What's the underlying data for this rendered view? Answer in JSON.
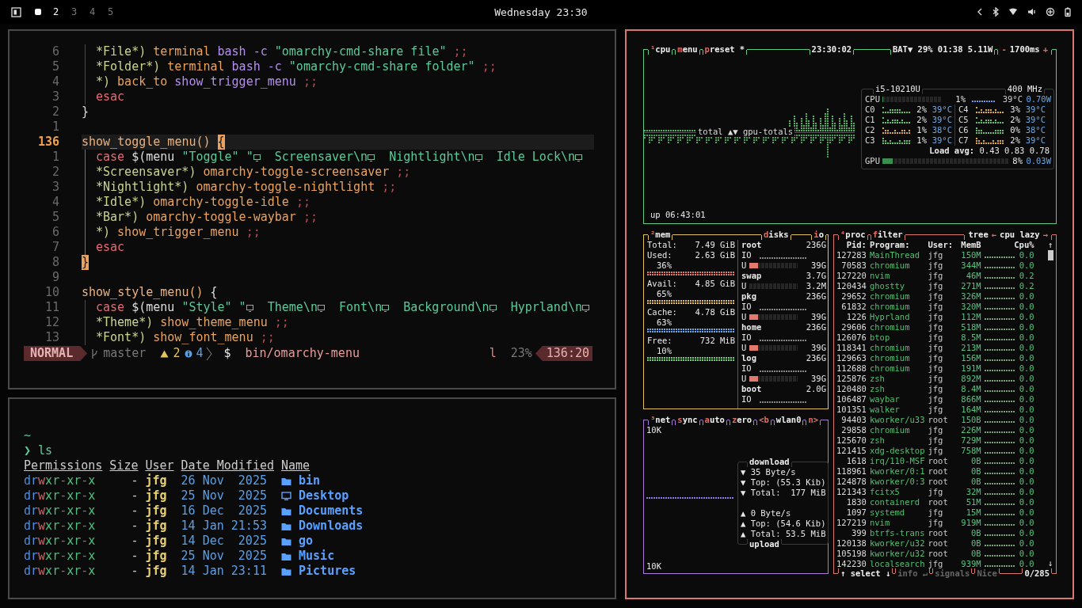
{
  "top_bar": {
    "workspaces": [
      {
        "kind": "icon",
        "selected": true
      },
      {
        "kind": "number",
        "label": "2",
        "selected": false,
        "occupied": true
      },
      {
        "kind": "number",
        "label": "3",
        "selected": false,
        "occupied": false
      },
      {
        "kind": "number",
        "label": "4",
        "selected": false,
        "occupied": false
      },
      {
        "kind": "number",
        "label": "5",
        "selected": false,
        "occupied": false
      }
    ],
    "clock": "Wednesday 23:30"
  },
  "editor": {
    "lines": [
      {
        "number": "6",
        "current": false,
        "guide": true,
        "active_scope": false,
        "tokens": [
          {
            "kind": "pattern",
            "text": "*File*) "
          },
          {
            "kind": "command",
            "text": "terminal "
          },
          {
            "kind": "builtin",
            "text": "bash -c "
          },
          {
            "kind": "string",
            "text": "\"omarchy-cmd-share file\" "
          },
          {
            "kind": "punct",
            "text": ";;"
          }
        ]
      },
      {
        "number": "5",
        "current": false,
        "guide": true,
        "active_scope": false,
        "tokens": [
          {
            "kind": "pattern",
            "text": "*Folder*) "
          },
          {
            "kind": "command",
            "text": "terminal "
          },
          {
            "kind": "builtin",
            "text": "bash -c "
          },
          {
            "kind": "string",
            "text": "\"omarchy-cmd-share folder\" "
          },
          {
            "kind": "punct",
            "text": ";;"
          }
        ]
      },
      {
        "number": "4",
        "current": false,
        "guide": true,
        "active_scope": false,
        "tokens": [
          {
            "kind": "pattern",
            "text": "*) "
          },
          {
            "kind": "command",
            "text": "back_to "
          },
          {
            "kind": "builtin",
            "text": "show_trigger_menu "
          },
          {
            "kind": "punct",
            "text": ";;"
          }
        ]
      },
      {
        "number": "3",
        "current": false,
        "guide": true,
        "active_scope": false,
        "tokens": [
          {
            "kind": "keyword",
            "text": "esac"
          }
        ]
      },
      {
        "number": "2",
        "current": false,
        "tokens": [
          {
            "kind": "plain",
            "text": "}"
          }
        ]
      },
      {
        "number": "1",
        "current": false
      },
      {
        "number": "136",
        "current": true,
        "tokens": [
          {
            "kind": "func",
            "text": "show_toggle_menu() "
          },
          {
            "kind": "match",
            "text": "{"
          }
        ]
      },
      {
        "number": "1",
        "current": false,
        "guide": true,
        "active_scope": true,
        "tokens": [
          {
            "kind": "keyword",
            "text": "case "
          },
          {
            "kind": "plain",
            "text": "$(menu "
          },
          {
            "kind": "string",
            "text": "\"Toggle\" \""
          },
          {
            "kind": "icon"
          },
          {
            "kind": "string",
            "text": "  Screensaver\\n"
          },
          {
            "kind": "icon"
          },
          {
            "kind": "string",
            "text": "  Nightlight\\n"
          },
          {
            "kind": "icon"
          },
          {
            "kind": "string",
            "text": "  Idle Lock\\n"
          },
          {
            "kind": "icon"
          }
        ]
      },
      {
        "number": "2",
        "current": false,
        "guide": true,
        "active_scope": true,
        "tokens": [
          {
            "kind": "pattern",
            "text": "*Screensaver*) "
          },
          {
            "kind": "command",
            "text": "omarchy-toggle-screensaver "
          },
          {
            "kind": "punct",
            "text": ";;"
          }
        ]
      },
      {
        "number": "3",
        "current": false,
        "guide": true,
        "active_scope": true,
        "tokens": [
          {
            "kind": "pattern",
            "text": "*Nightlight*) "
          },
          {
            "kind": "command",
            "text": "omarchy-toggle-nightlight "
          },
          {
            "kind": "punct",
            "text": ";;"
          }
        ]
      },
      {
        "number": "4",
        "current": false,
        "guide": true,
        "active_scope": true,
        "tokens": [
          {
            "kind": "pattern",
            "text": "*Idle*) "
          },
          {
            "kind": "command",
            "text": "omarchy-toggle-idle "
          },
          {
            "kind": "punct",
            "text": ";;"
          }
        ]
      },
      {
        "number": "5",
        "current": false,
        "guide": true,
        "active_scope": true,
        "tokens": [
          {
            "kind": "pattern",
            "text": "*Bar*) "
          },
          {
            "kind": "command",
            "text": "omarchy-toggle-waybar "
          },
          {
            "kind": "punct",
            "text": ";;"
          }
        ]
      },
      {
        "number": "6",
        "current": false,
        "guide": true,
        "active_scope": true,
        "tokens": [
          {
            "kind": "pattern",
            "text": "*) "
          },
          {
            "kind": "command",
            "text": "show_trigger_menu "
          },
          {
            "kind": "punct",
            "text": ";;"
          }
        ]
      },
      {
        "number": "7",
        "current": false,
        "guide": true,
        "active_scope": true,
        "tokens": [
          {
            "kind": "keyword",
            "text": "esac"
          }
        ]
      },
      {
        "number": "8",
        "current": false,
        "tokens": [
          {
            "kind": "match",
            "text": "}"
          }
        ]
      },
      {
        "number": "9",
        "current": false
      },
      {
        "number": "10",
        "current": false,
        "tokens": [
          {
            "kind": "func",
            "text": "show_style_menu() "
          },
          {
            "kind": "plain",
            "text": "{"
          }
        ]
      },
      {
        "number": "11",
        "current": false,
        "guide": true,
        "active_scope": false,
        "tokens": [
          {
            "kind": "keyword",
            "text": "case "
          },
          {
            "kind": "plain",
            "text": "$(menu "
          },
          {
            "kind": "string",
            "text": "\"Style\" \""
          },
          {
            "kind": "icon"
          },
          {
            "kind": "string",
            "text": "  Theme\\n"
          },
          {
            "kind": "icon"
          },
          {
            "kind": "string",
            "text": "  Font\\n"
          },
          {
            "kind": "icon"
          },
          {
            "kind": "string",
            "text": "  Background\\n"
          },
          {
            "kind": "icon"
          },
          {
            "kind": "string",
            "text": "  Hyprland\\n"
          },
          {
            "kind": "icon"
          }
        ]
      },
      {
        "number": "12",
        "current": false,
        "guide": true,
        "active_scope": false,
        "tokens": [
          {
            "kind": "pattern",
            "text": "*Theme*) "
          },
          {
            "kind": "command",
            "text": "show_theme_menu "
          },
          {
            "kind": "punct",
            "text": ";;"
          }
        ]
      },
      {
        "number": "13",
        "current": false,
        "guide": true,
        "active_scope": false,
        "tokens": [
          {
            "kind": "pattern",
            "text": "*Font*) "
          },
          {
            "kind": "command",
            "text": "show_font_menu "
          },
          {
            "kind": "punct",
            "text": ";;"
          }
        ]
      }
    ],
    "status": {
      "mode": "NORMAL",
      "branch": "master",
      "warnings": "2",
      "infos": "4",
      "prompt": "$",
      "file": "bin/omarchy-menu",
      "flag": "l",
      "percent": "23%",
      "position": "136:20"
    }
  },
  "shell": {
    "cwd": "~",
    "prompt": "❯",
    "command": "ls",
    "columns": [
      "Permissions",
      "Size",
      "User",
      "Date Modified",
      "Name"
    ],
    "rows": [
      {
        "permissions": "drwxr-xr-x",
        "size": "-",
        "user": "jfg",
        "date": "26 Nov  2025",
        "name": "bin",
        "kind": "folder"
      },
      {
        "permissions": "drwxr-xr-x",
        "size": "-",
        "user": "jfg",
        "date": "25 Nov  2025",
        "name": "Desktop",
        "kind": "monitor"
      },
      {
        "permissions": "drwxr-xr-x",
        "size": "-",
        "user": "jfg",
        "date": "16 Dec  2025",
        "name": "Documents",
        "kind": "folder"
      },
      {
        "permissions": "drwxr-xr-x",
        "size": "-",
        "user": "jfg",
        "date": "14 Jan 21:53",
        "name": "Downloads",
        "kind": "folder"
      },
      {
        "permissions": "drwxr-xr-x",
        "size": "-",
        "user": "jfg",
        "date": "14 Dec  2025",
        "name": "go",
        "kind": "folder"
      },
      {
        "permissions": "drwxr-xr-x",
        "size": "-",
        "user": "jfg",
        "date": "25 Nov  2025",
        "name": "Music",
        "kind": "folder"
      },
      {
        "permissions": "drwxr-xr-x",
        "size": "-",
        "user": "jfg",
        "date": "14 Jan 23:11",
        "name": "Pictures",
        "kind": "folder"
      }
    ]
  },
  "monitor": {
    "cpu": {
      "tabs": [
        {
          "text": "¹cpu",
          "kind": "hotkey"
        },
        {
          "text": "menu",
          "kind": "hotkey"
        },
        {
          "text": "preset *",
          "kind": "hotkey"
        }
      ],
      "clock": "23:30:02",
      "battery": "BAT▼ 29% 01:38 5.11W",
      "interval": [
        {
          "text": "-",
          "kind": "control"
        },
        {
          "text": "1700ms",
          "kind": "plain"
        },
        {
          "text": "+",
          "kind": "control"
        }
      ],
      "graph_label": "total ▲▼ gpu-totals",
      "uptime": "up 06:43:01",
      "model": "i5-10210U",
      "frequency": "400 MHz",
      "total": {
        "label": "CPU",
        "percent": "1%",
        "level": 0.01,
        "temp": "39°C",
        "power": "0.70W"
      },
      "cores": [
        {
          "label": "C0",
          "percent": "2%",
          "temp": "39°C"
        },
        {
          "label": "C4",
          "percent": "3%",
          "temp": "39°C"
        },
        {
          "label": "C1",
          "percent": "2%",
          "temp": "39°C"
        },
        {
          "label": "C5",
          "percent": "2%",
          "temp": "39°C"
        },
        {
          "label": "C2",
          "percent": "1%",
          "temp": "38°C"
        },
        {
          "label": "C6",
          "percent": "0%",
          "temp": "38°C"
        },
        {
          "label": "C3",
          "percent": "1%",
          "temp": "39°C"
        },
        {
          "label": "C7",
          "percent": "2%",
          "temp": "39°C"
        }
      ],
      "load": "**Load avg:** 0.43 0.83 0.78",
      "gpu": {
        "label": "GPU",
        "percent": "8%",
        "level": 0.08,
        "power": "0.03W"
      }
    },
    "mem": {
      "title": {
        "text": "²mem",
        "kind": "hotkey"
      },
      "items": [
        {
          "label": "Total:",
          "value": "7.49 GiB"
        },
        {
          "label": "Used:",
          "value": "2.63 GiB",
          "percent": "36%",
          "color": "#e07a6f"
        },
        {
          "label": "Avail:",
          "value": "4.85 GiB",
          "percent": "65%",
          "color": "#e0c060"
        },
        {
          "label": "Cache:",
          "value": "4.78 GiB",
          "percent": "63%",
          "color": "#6aa8e8"
        },
        {
          "label": "Free:",
          "value": "732 MiB",
          "percent": "10%",
          "color": "#6ad07a"
        }
      ]
    },
    "disks": {
      "tabs": [
        {
          "text": "disks",
          "kind": "hotkey"
        },
        {
          "text": "io",
          "kind": "hotkey"
        }
      ],
      "items": [
        {
          "name": "root",
          "size": "236G",
          "io": "IO",
          "usage": {
            "label": "U",
            "value": "39G",
            "level": 0.17
          }
        },
        {
          "name": "swap",
          "size": "3.7G",
          "usage": {
            "label": "U",
            "value": "3.2M",
            "level": 0
          }
        },
        {
          "name": "pkg",
          "size": "236G",
          "io": "IO",
          "usage": {
            "label": "U",
            "value": "39G",
            "level": 0.17
          }
        },
        {
          "name": "home",
          "size": "236G",
          "io": "IO",
          "usage": {
            "label": "U",
            "value": "39G",
            "level": 0.17
          }
        },
        {
          "name": "log",
          "size": "236G",
          "io": "IO",
          "usage": {
            "label": "U",
            "value": "39G",
            "level": 0.17
          }
        },
        {
          "name": "boot",
          "size": "2.0G",
          "io": "IO"
        }
      ]
    },
    "net": {
      "tabs": [
        {
          "text": "³net",
          "kind": "hotkey"
        },
        {
          "text": "sync",
          "kind": "hotkey"
        },
        {
          "text": "auto",
          "kind": "hotkey"
        },
        {
          "text": "zero",
          "kind": "hotkey"
        }
      ],
      "interface": [
        {
          "text": "<b",
          "kind": "control"
        },
        {
          "text": "wlan0",
          "kind": "plain"
        },
        {
          "text": "n>",
          "kind": "control"
        }
      ],
      "scale_top": "10K",
      "scale_bottom": "10K",
      "download_title": "download",
      "download": [
        "▼ 35 Byte/s",
        "▼ Top: (55.3 Kib)",
        "▼ Total:  177 MiB"
      ],
      "upload": [
        "▲ 0 Byte/s",
        "▲ Top: (54.6 Kib)",
        "▲ Total: 53.5 MiB"
      ],
      "upload_title": "upload"
    },
    "proc": {
      "tabs": [
        {
          "text": "⁴proc",
          "kind": "hotkey"
        },
        {
          "text": "filter",
          "kind": "hotkey"
        }
      ],
      "options": [
        {
          "text": "tree",
          "kind": "plain"
        },
        {
          "text": "←",
          "kind": "control"
        },
        {
          "text": "cpu lazy",
          "kind": "plain"
        },
        {
          "text": "→",
          "kind": "control"
        }
      ],
      "columns": [
        "Pid:",
        "Program:",
        "User:",
        "MemB",
        "Cpu%"
      ],
      "scroll_up": "↑",
      "scroll_down": "↓",
      "rows": [
        {
          "pid": "127283",
          "program": "MainThread",
          "user": "jfg",
          "mem": "150M",
          "cpu": "0.0"
        },
        {
          "pid": "70583",
          "program": "chromium",
          "user": "jfg",
          "mem": "344M",
          "cpu": "0.0"
        },
        {
          "pid": "127220",
          "program": "nvim",
          "user": "jfg",
          "mem": "46M",
          "cpu": "0.2"
        },
        {
          "pid": "120434",
          "program": "ghostty",
          "user": "jfg",
          "mem": "271M",
          "cpu": "0.2"
        },
        {
          "pid": "29652",
          "program": "chromium",
          "user": "jfg",
          "mem": "326M",
          "cpu": "0.0"
        },
        {
          "pid": "61832",
          "program": "chromium",
          "user": "jfg",
          "mem": "320M",
          "cpu": "0.0"
        },
        {
          "pid": "1226",
          "program": "Hyprland",
          "user": "jfg",
          "mem": "112M",
          "cpu": "0.0"
        },
        {
          "pid": "29606",
          "program": "chromium",
          "user": "jfg",
          "mem": "518M",
          "cpu": "0.0"
        },
        {
          "pid": "126076",
          "program": "btop",
          "user": "jfg",
          "mem": "8.5M",
          "cpu": "0.0"
        },
        {
          "pid": "118341",
          "program": "chromium",
          "user": "jfg",
          "mem": "213M",
          "cpu": "0.0"
        },
        {
          "pid": "129663",
          "program": "chromium",
          "user": "jfg",
          "mem": "156M",
          "cpu": "0.0"
        },
        {
          "pid": "112688",
          "program": "chromium",
          "user": "jfg",
          "mem": "191M",
          "cpu": "0.0"
        },
        {
          "pid": "125876",
          "program": "zsh",
          "user": "jfg",
          "mem": "892M",
          "cpu": "0.0"
        },
        {
          "pid": "120480",
          "program": "zsh",
          "user": "jfg",
          "mem": "8.4M",
          "cpu": "0.0"
        },
        {
          "pid": "106487",
          "program": "waybar",
          "user": "jfg",
          "mem": "866M",
          "cpu": "0.0"
        },
        {
          "pid": "101351",
          "program": "walker",
          "user": "jfg",
          "mem": "164M",
          "cpu": "0.0"
        },
        {
          "pid": "94403",
          "program": "kworker/u33",
          "user": "root",
          "mem": "150B",
          "cpu": "0.0"
        },
        {
          "pid": "29858",
          "program": "chromium",
          "user": "jfg",
          "mem": "226M",
          "cpu": "0.0"
        },
        {
          "pid": "125670",
          "program": "zsh",
          "user": "jfg",
          "mem": "729M",
          "cpu": "0.0"
        },
        {
          "pid": "121415",
          "program": "xdg-desktop",
          "user": "jfg",
          "mem": "758M",
          "cpu": "0.0"
        },
        {
          "pid": "1618",
          "program": "irq/110-MSF",
          "user": "root",
          "mem": "0B",
          "cpu": "0.0"
        },
        {
          "pid": "118961",
          "program": "kworker/0:1",
          "user": "root",
          "mem": "0B",
          "cpu": "0.0"
        },
        {
          "pid": "124878",
          "program": "kworker/0:3",
          "user": "root",
          "mem": "0B",
          "cpu": "0.0"
        },
        {
          "pid": "121343",
          "program": "fcitx5",
          "user": "jfg",
          "mem": "32M",
          "cpu": "0.0"
        },
        {
          "pid": "1830",
          "program": "containerd",
          "user": "root",
          "mem": "51M",
          "cpu": "0.0"
        },
        {
          "pid": "1097",
          "program": "systemd",
          "user": "jfg",
          "mem": "15M",
          "cpu": "0.0"
        },
        {
          "pid": "127219",
          "program": "nvim",
          "user": "jfg",
          "mem": "919M",
          "cpu": "0.0"
        },
        {
          "pid": "399",
          "program": "btrfs-trans",
          "user": "root",
          "mem": "0B",
          "cpu": "0.0"
        },
        {
          "pid": "120138",
          "program": "kworker/u32",
          "user": "root",
          "mem": "0B",
          "cpu": "0.0"
        },
        {
          "pid": "105198",
          "program": "kworker/u32",
          "user": "root",
          "mem": "0B",
          "cpu": "0.0"
        },
        {
          "pid": "142230",
          "program": "localsearch",
          "user": "jfg",
          "mem": "939M",
          "cpu": "0.0"
        }
      ],
      "footer": [
        {
          "text": "↑ select ↓",
          "dim": false
        },
        {
          "text": "info ↵",
          "dim": true
        },
        {
          "text": "signals",
          "dim": true
        },
        {
          "text": "Nice",
          "dim": true
        }
      ],
      "count": "0/285"
    }
  }
}
